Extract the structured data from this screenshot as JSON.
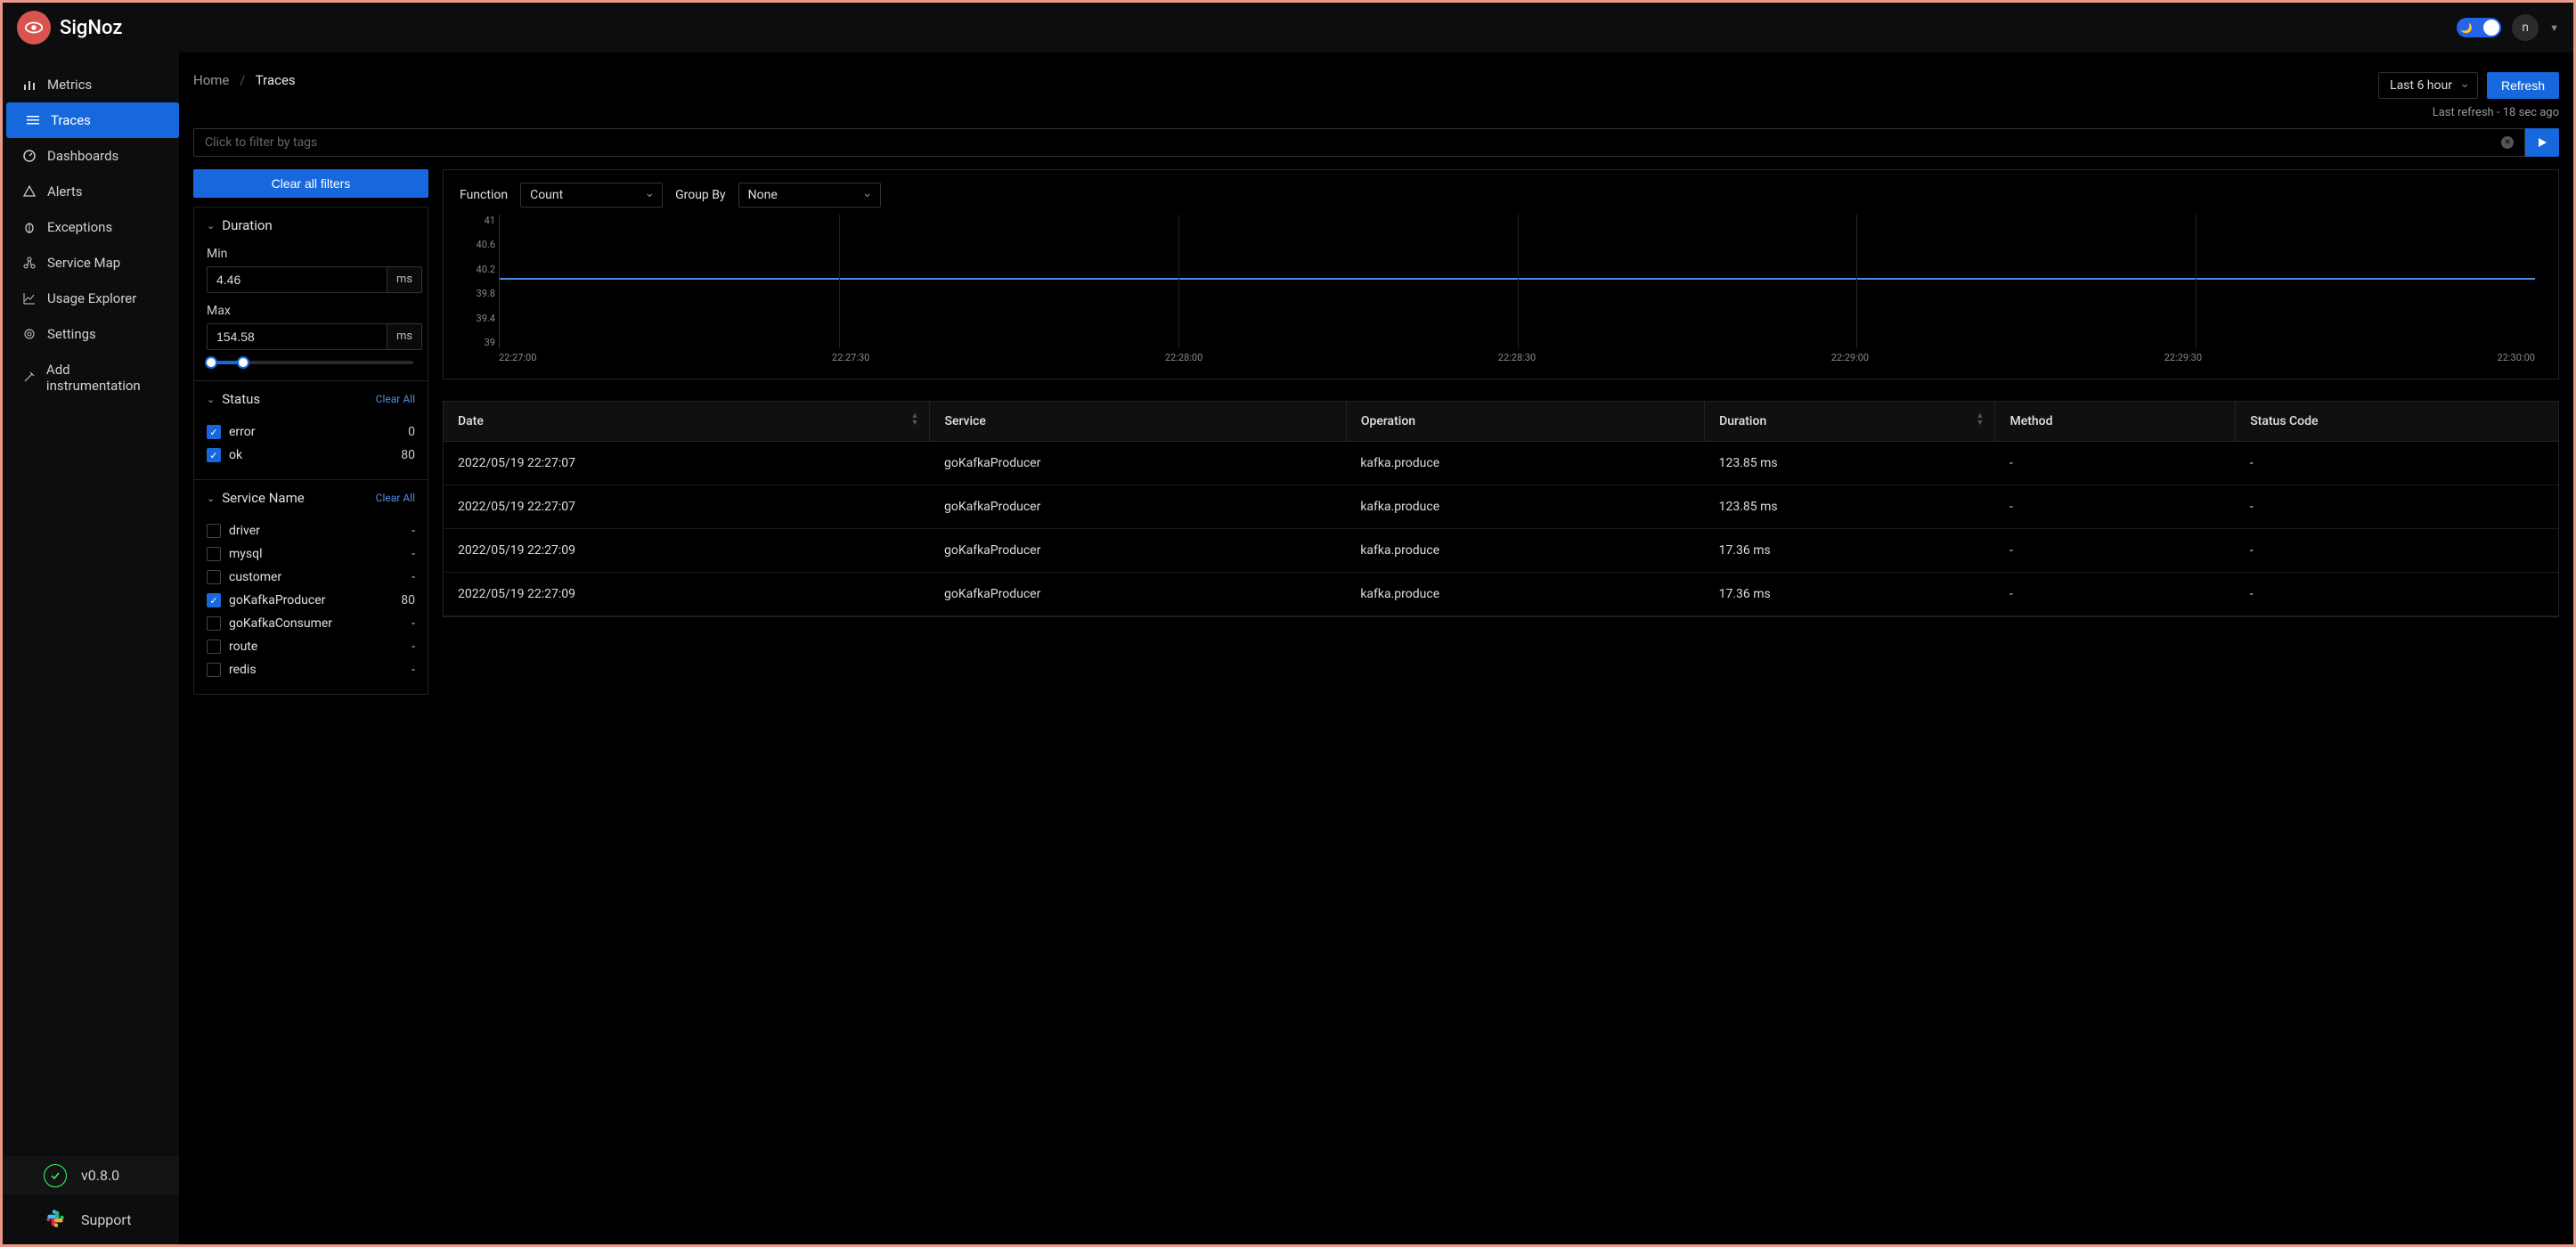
{
  "brand": "SigNoz",
  "header": {
    "avatar_letter": "n"
  },
  "sidebar": {
    "items": [
      {
        "label": "Metrics",
        "icon": "bar-chart-icon"
      },
      {
        "label": "Traces",
        "icon": "menu-icon",
        "active": true
      },
      {
        "label": "Dashboards",
        "icon": "dashboard-icon"
      },
      {
        "label": "Alerts",
        "icon": "alert-icon"
      },
      {
        "label": "Exceptions",
        "icon": "bug-icon"
      },
      {
        "label": "Service Map",
        "icon": "network-icon"
      },
      {
        "label": "Usage Explorer",
        "icon": "line-chart-icon"
      },
      {
        "label": "Settings",
        "icon": "gear-icon"
      },
      {
        "label": "Add instrumentation",
        "icon": "instrument-icon"
      }
    ],
    "version": "v0.8.0",
    "support": "Support"
  },
  "breadcrumb": {
    "home": "Home",
    "current": "Traces"
  },
  "toolbar": {
    "time_range": "Last 6 hour",
    "refresh": "Refresh",
    "last_refresh": "Last refresh - 18 sec ago",
    "filter_placeholder": "Click to filter by tags",
    "clear_all_filters": "Clear all filters"
  },
  "filters": {
    "duration": {
      "title": "Duration",
      "min_label": "Min",
      "max_label": "Max",
      "min": "4.46",
      "max": "154.58",
      "unit": "ms"
    },
    "status": {
      "title": "Status",
      "clear": "Clear All",
      "items": [
        {
          "label": "error",
          "count": "0",
          "checked": true
        },
        {
          "label": "ok",
          "count": "80",
          "checked": true
        }
      ]
    },
    "service": {
      "title": "Service Name",
      "clear": "Clear All",
      "items": [
        {
          "label": "driver",
          "count": "-",
          "checked": false
        },
        {
          "label": "mysql",
          "count": "-",
          "checked": false
        },
        {
          "label": "customer",
          "count": "-",
          "checked": false
        },
        {
          "label": "goKafkaProducer",
          "count": "80",
          "checked": true
        },
        {
          "label": "goKafkaConsumer",
          "count": "-",
          "checked": false
        },
        {
          "label": "route",
          "count": "-",
          "checked": false
        },
        {
          "label": "redis",
          "count": "-",
          "checked": false
        }
      ]
    }
  },
  "chart": {
    "function_label": "Function",
    "function_value": "Count",
    "groupby_label": "Group By",
    "groupby_value": "None"
  },
  "chart_data": {
    "type": "line",
    "title": "",
    "xlabel": "",
    "ylabel": "",
    "ylim": [
      39,
      41
    ],
    "y_ticks": [
      "41",
      "40.6",
      "40.2",
      "39.8",
      "39.4",
      "39"
    ],
    "x_ticks": [
      "22:27:00",
      "22:27:30",
      "22:28:00",
      "22:28:30",
      "22:29:00",
      "22:29:30",
      "22:30:00"
    ],
    "series": [
      {
        "name": "count",
        "values": [
          40.1,
          40.1,
          40.1,
          40.1,
          40.1,
          40.1,
          40.1
        ]
      }
    ]
  },
  "table": {
    "columns": [
      "Date",
      "Service",
      "Operation",
      "Duration",
      "Method",
      "Status Code"
    ],
    "rows": [
      {
        "date": "2022/05/19 22:27:07",
        "service": "goKafkaProducer",
        "operation": "kafka.produce",
        "duration": "123.85 ms",
        "method": "-",
        "status": "-"
      },
      {
        "date": "2022/05/19 22:27:07",
        "service": "goKafkaProducer",
        "operation": "kafka.produce",
        "duration": "123.85 ms",
        "method": "-",
        "status": "-"
      },
      {
        "date": "2022/05/19 22:27:09",
        "service": "goKafkaProducer",
        "operation": "kafka.produce",
        "duration": "17.36 ms",
        "method": "-",
        "status": "-"
      },
      {
        "date": "2022/05/19 22:27:09",
        "service": "goKafkaProducer",
        "operation": "kafka.produce",
        "duration": "17.36 ms",
        "method": "-",
        "status": "-"
      }
    ]
  }
}
